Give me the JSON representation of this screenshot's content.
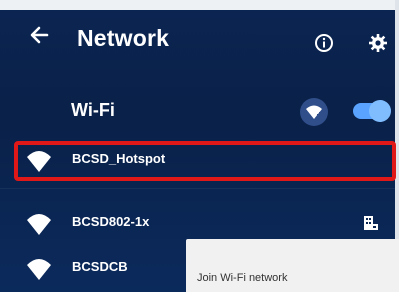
{
  "header": {
    "title": "Network",
    "back_icon": "back-arrow-icon",
    "info_icon": "info-icon",
    "settings_icon": "gear-icon"
  },
  "wifi": {
    "label": "Wi-Fi",
    "add_icon": "add-network-icon",
    "enabled": true
  },
  "networks": [
    {
      "name": "BCSD_Hotspot",
      "icon": "wifi-signal-icon",
      "secured": false,
      "highlighted": true
    },
    {
      "name": "BCSD802-1x",
      "icon": "wifi-signal-icon",
      "secured": true,
      "secure_icon": "enterprise-lock-icon"
    },
    {
      "name": "BCSDCB",
      "icon": "wifi-signal-icon",
      "secured": false
    }
  ],
  "dialog": {
    "title": "Join Wi-Fi network"
  },
  "colors": {
    "background": "#0b2552",
    "highlight": "#e01818",
    "toggle": "#5aa4ff"
  }
}
